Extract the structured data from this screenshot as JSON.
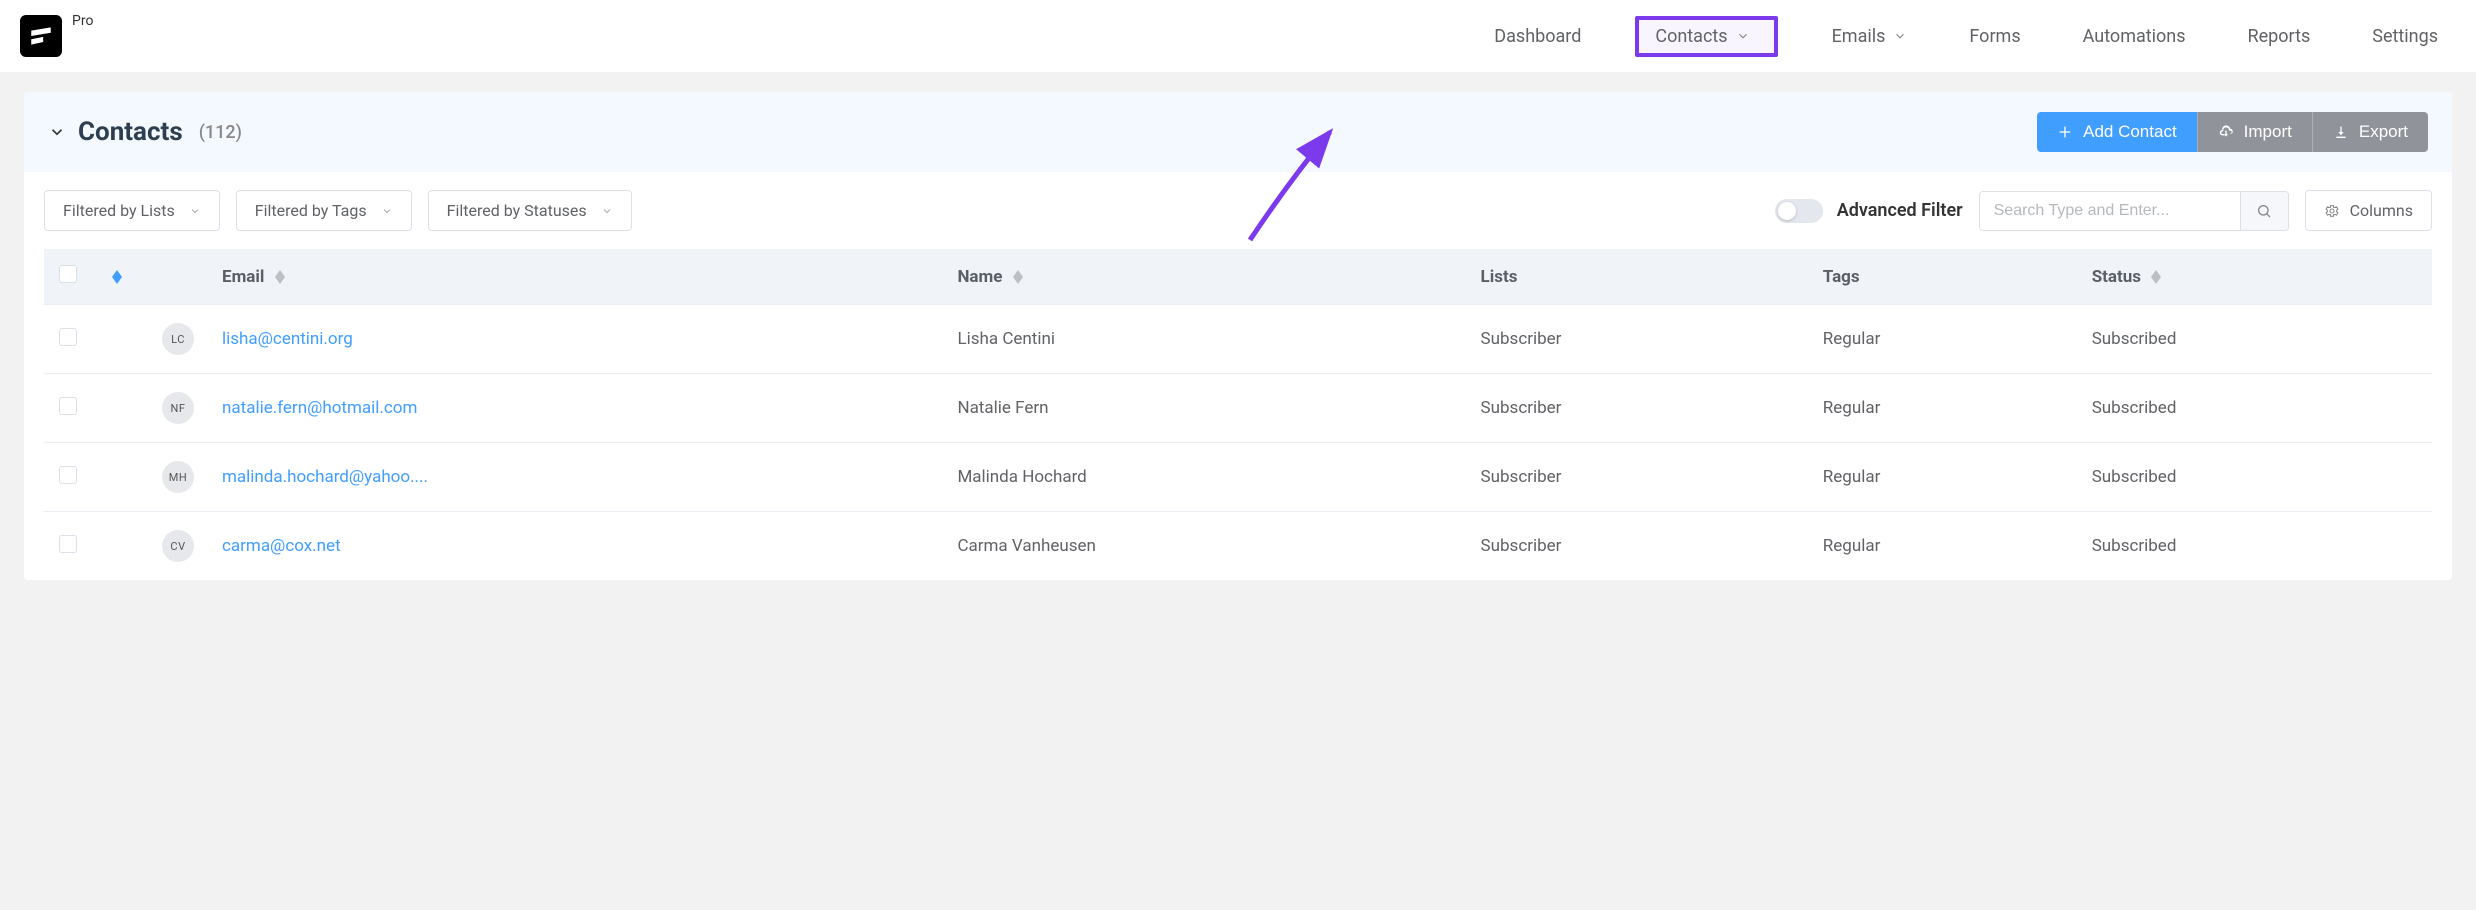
{
  "brand": {
    "pro_label": "Pro"
  },
  "nav": {
    "dashboard": "Dashboard",
    "contacts": "Contacts",
    "emails": "Emails",
    "forms": "Forms",
    "automations": "Automations",
    "reports": "Reports",
    "settings": "Settings"
  },
  "header": {
    "title": "Contacts",
    "count": "(112)",
    "add_contact": "Add Contact",
    "import": "Import",
    "export": "Export"
  },
  "filters": {
    "lists": "Filtered by Lists",
    "tags": "Filtered by Tags",
    "statuses": "Filtered by Statuses",
    "advanced": "Advanced Filter",
    "search_placeholder": "Search Type and Enter...",
    "columns": "Columns"
  },
  "table": {
    "headers": {
      "email": "Email",
      "name": "Name",
      "lists": "Lists",
      "tags": "Tags",
      "status": "Status"
    },
    "rows": [
      {
        "initials": "LC",
        "email": "lisha@centini.org",
        "name": "Lisha Centini",
        "lists": "Subscriber",
        "tags": "Regular",
        "status": "Subscribed"
      },
      {
        "initials": "NF",
        "email": "natalie.fern@hotmail.com",
        "name": "Natalie Fern",
        "lists": "Subscriber",
        "tags": "Regular",
        "status": "Subscribed"
      },
      {
        "initials": "MH",
        "email": "malinda.hochard@yahoo....",
        "name": "Malinda Hochard",
        "lists": "Subscriber",
        "tags": "Regular",
        "status": "Subscribed"
      },
      {
        "initials": "CV",
        "email": "carma@cox.net",
        "name": "Carma Vanheusen",
        "lists": "Subscriber",
        "tags": "Regular",
        "status": "Subscribed"
      }
    ]
  }
}
